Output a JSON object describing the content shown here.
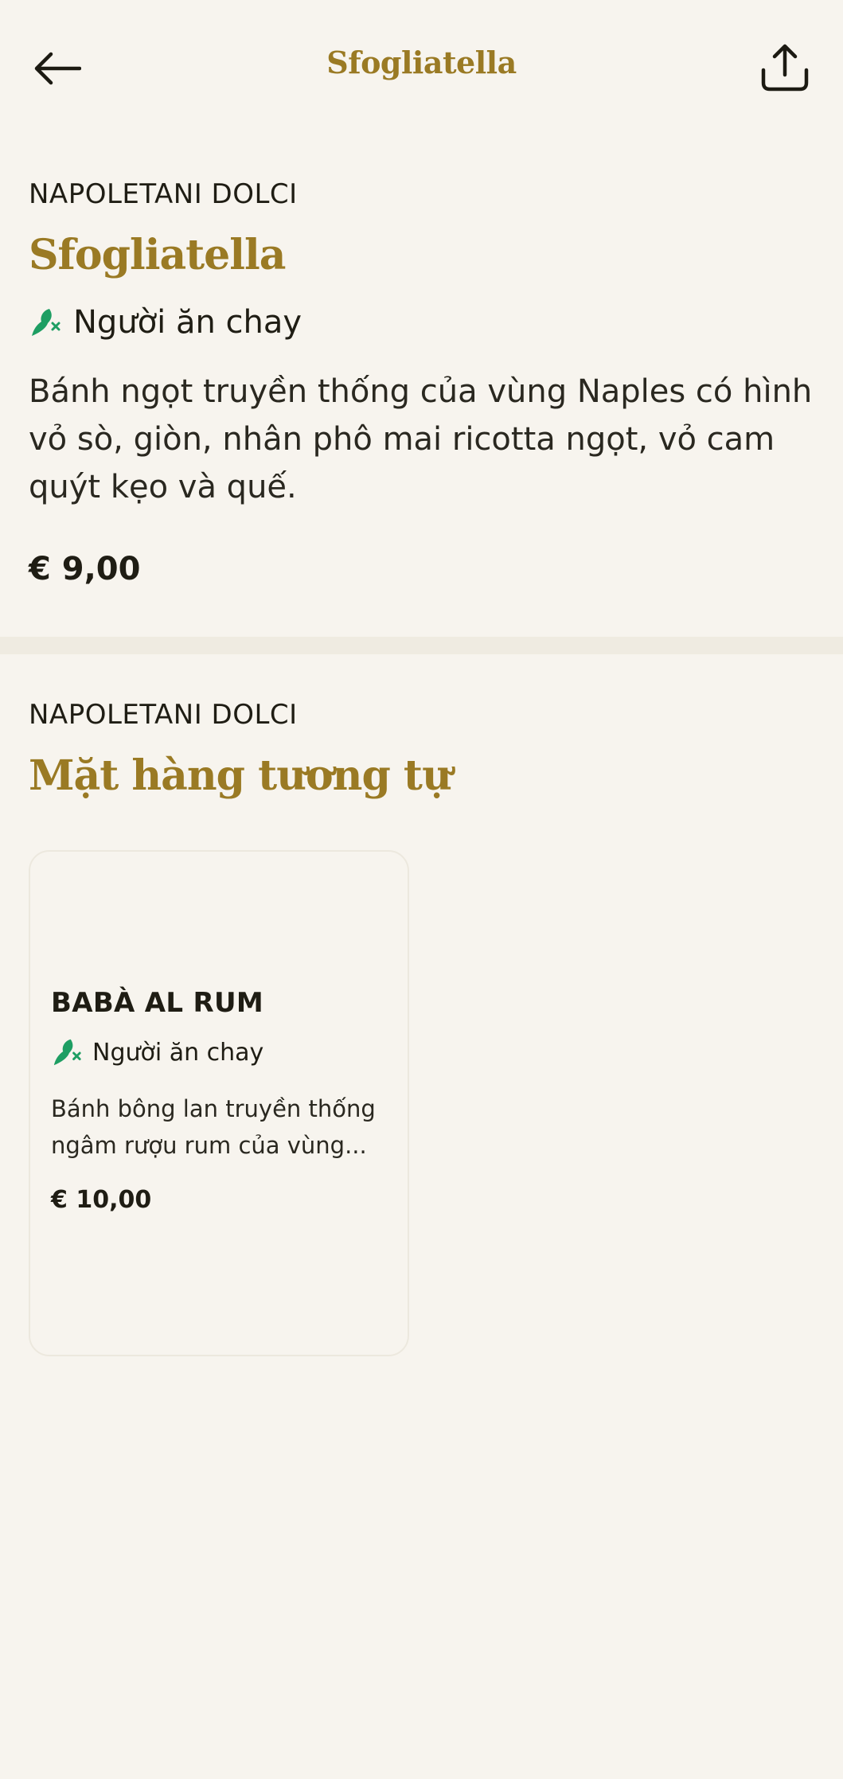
{
  "header": {
    "title": "Sfogliatella",
    "back_icon": "arrow-left-icon",
    "share_icon": "share-icon"
  },
  "item": {
    "category": "NAPOLETANI DOLCI",
    "title": "Sfogliatella",
    "tag": "Người ăn chay",
    "tag_icon": "vegetarian-icon",
    "description": "Bánh ngọt truyền thống của vùng Naples có hình vỏ sò, giòn, nhân phô mai ricotta ngọt, vỏ cam quýt kẹo và quế.",
    "price": "€ 9,00"
  },
  "similar": {
    "category": "NAPOLETANI DOLCI",
    "heading": "Mặt hàng tương tự",
    "items": [
      {
        "title": "BABÀ AL RUM",
        "tag": "Người ăn chay",
        "description": "Bánh bông lan truyền thống ngâm rượu rum của vùng...",
        "price": "€ 10,00"
      }
    ]
  },
  "colors": {
    "background": "#f7f4ee",
    "accent_gold": "#9a7a24",
    "vegetarian_green": "#1e9e63",
    "text": "#1f1d14",
    "divider": "#efebe1"
  }
}
